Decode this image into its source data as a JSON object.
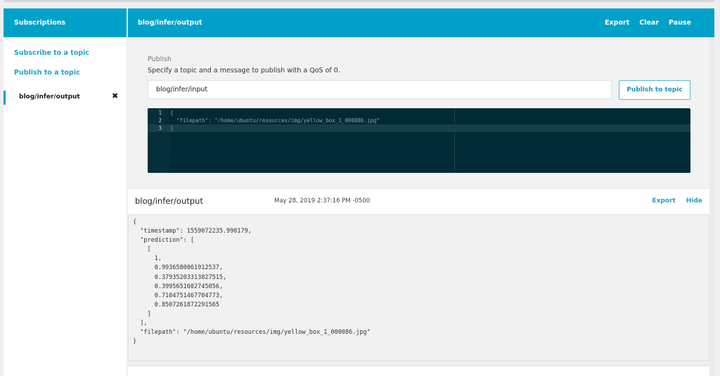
{
  "sidebar": {
    "title": "Subscriptions",
    "links": [
      {
        "label": "Subscribe to a topic"
      },
      {
        "label": "Publish to a topic"
      }
    ],
    "subscriptions": [
      {
        "topic": "blog/infer/output",
        "close_icon": "✖"
      }
    ]
  },
  "main": {
    "header": {
      "title": "blog/infer/output",
      "actions": [
        {
          "label": "Export"
        },
        {
          "label": "Clear"
        },
        {
          "label": "Pause"
        }
      ]
    },
    "publish": {
      "title": "Publish",
      "description": "Specify a topic and a message to publish with a QoS of 0.",
      "topic_value": "blog/infer/input",
      "button_label": "Publish to topic",
      "editor_lines": [
        {
          "num": "1",
          "text": "{"
        },
        {
          "num": "2",
          "text": "  \"filepath\": \"/home/ubuntu/resources/img/yellow_box_1_000086.jpg\""
        },
        {
          "num": "3",
          "text": "}"
        }
      ]
    },
    "message": {
      "topic": "blog/infer/output",
      "timestamp": "May 28, 2019 2:37:16 PM -0500",
      "actions": [
        {
          "label": "Export"
        },
        {
          "label": "Hide"
        }
      ],
      "payload": "{\n  \"timestamp\": 1559072235.990179,\n  \"prediction\": [\n    [\n      1,\n      0.9936580061912537,\n      0.37935203313827515,\n      0.3995651602745056,\n      0.7104751467704773,\n      0.8507261872291565\n    ]\n  ],\n  \"filepath\": \"/home/ubuntu/resources/img/yellow_box_1_000086.jpg\"\n}"
    }
  },
  "colors": {
    "accent": "#00a1c9",
    "link": "#1fa3c3",
    "editor_bg": "#002b36"
  }
}
